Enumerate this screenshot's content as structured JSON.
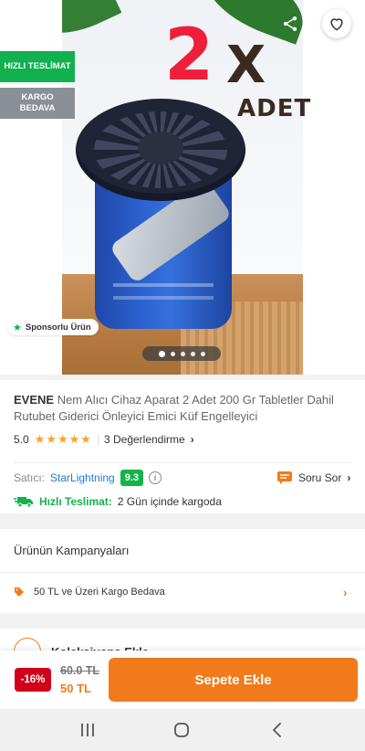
{
  "hero": {
    "promo_number": "2",
    "promo_x": "X",
    "promo_word": "ADET",
    "badges": {
      "fast": "HIZLI TESLİMAT",
      "cargo": "KARGO BEDAVA"
    },
    "sponsored": "Sponsorlu Ürün",
    "icons": {
      "back": "arrow-left-icon",
      "share": "share-icon",
      "favorite": "heart-icon",
      "sponsored": "star-icon"
    },
    "carousel": {
      "total": 5,
      "active": 1
    }
  },
  "product": {
    "brand": "EVENE",
    "name": " Nem Alıcı Cihaz Aparat 2 Adet 200 Gr Tabletler Dahil Rutubet Giderici Önleyici Emici Küf Engelleyici",
    "rating": "5.0",
    "stars": "★★★★★",
    "reviews": "3 Değerlendirme",
    "seller_label": "Satıcı:",
    "seller_name": "StarLightning",
    "seller_score": "9.3",
    "ask_label": "Soru Sor",
    "delivery_label": "Hızlı Teslimat:",
    "delivery_value": "2 Gün içinde kargoda"
  },
  "campaigns": {
    "title": "Ürünün Kampanyaları",
    "item": "50 TL ve Üzeri Kargo Bedava"
  },
  "collection": {
    "label": "Koleksiyona Ekle"
  },
  "purchase": {
    "discount": "-16%",
    "old_price": "60.0 TL",
    "new_price": "50 TL",
    "cta": "Sepete Ekle"
  },
  "colors": {
    "accent": "#f27a1a",
    "green": "#12b24d",
    "discount": "#d0021b",
    "link": "#1f7bd6"
  }
}
